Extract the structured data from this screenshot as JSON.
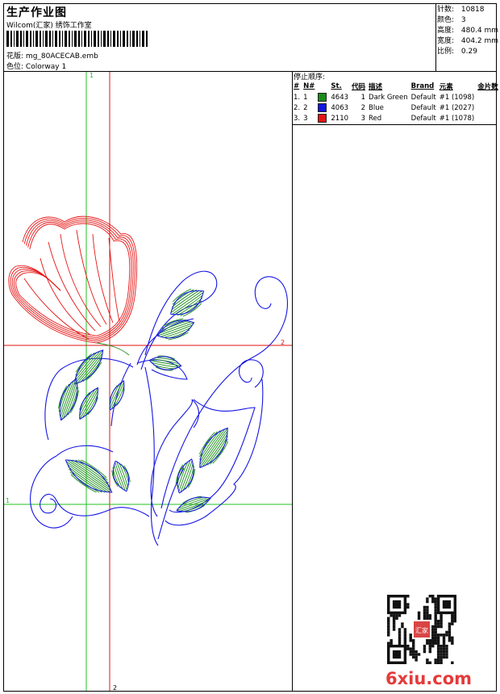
{
  "header": {
    "title": "生产作业图",
    "studio": "Wilcom(汇家) 绣饰工作室",
    "design_label": "花版:",
    "design_file": "mg_80ACECAB.emb",
    "colorway_label": "色位:",
    "colorway": "Colorway 1"
  },
  "stats": [
    {
      "label": "针数:",
      "value": "10818"
    },
    {
      "label": "颜色:",
      "value": "3"
    },
    {
      "label": "高度:",
      "value": "480.4 mm"
    },
    {
      "label": "宽度:",
      "value": "404.2 mm"
    },
    {
      "label": "比例:",
      "value": "0.29"
    }
  ],
  "stop_sequence": {
    "label": "停止顺序:",
    "columns": [
      "#",
      "N#",
      "St.",
      "代码",
      "描述",
      "Brand",
      "元素",
      "金片数"
    ],
    "rows": [
      {
        "index": "1.",
        "n": "1",
        "color": "#1a8c1a",
        "stitches": "4643",
        "code": "1",
        "desc": "Dark Green",
        "brand": "Default",
        "element": "#1 (1098)"
      },
      {
        "index": "2.",
        "n": "2",
        "color": "#1414e6",
        "stitches": "4063",
        "code": "2",
        "desc": "Blue",
        "brand": "Default",
        "element": "#1 (2027)"
      },
      {
        "index": "3.",
        "n": "3",
        "color": "#e61414",
        "stitches": "2110",
        "code": "3",
        "desc": "Red",
        "brand": "Default",
        "element": "#1 (1078)"
      }
    ]
  },
  "guides": {
    "v1": "1",
    "v2": "2",
    "h1": "1",
    "h2": "2"
  },
  "footer": {
    "watermark": "6xiu.com",
    "seal_text": "汇家"
  },
  "icons": {
    "qr": "qr-code-icon",
    "seal": "seal-stamp-icon"
  },
  "colors": {
    "green": "#1a8c1a",
    "blue": "#1414e6",
    "red": "#e61414",
    "guide_green": "#22c022",
    "guide_red": "#e01010"
  }
}
